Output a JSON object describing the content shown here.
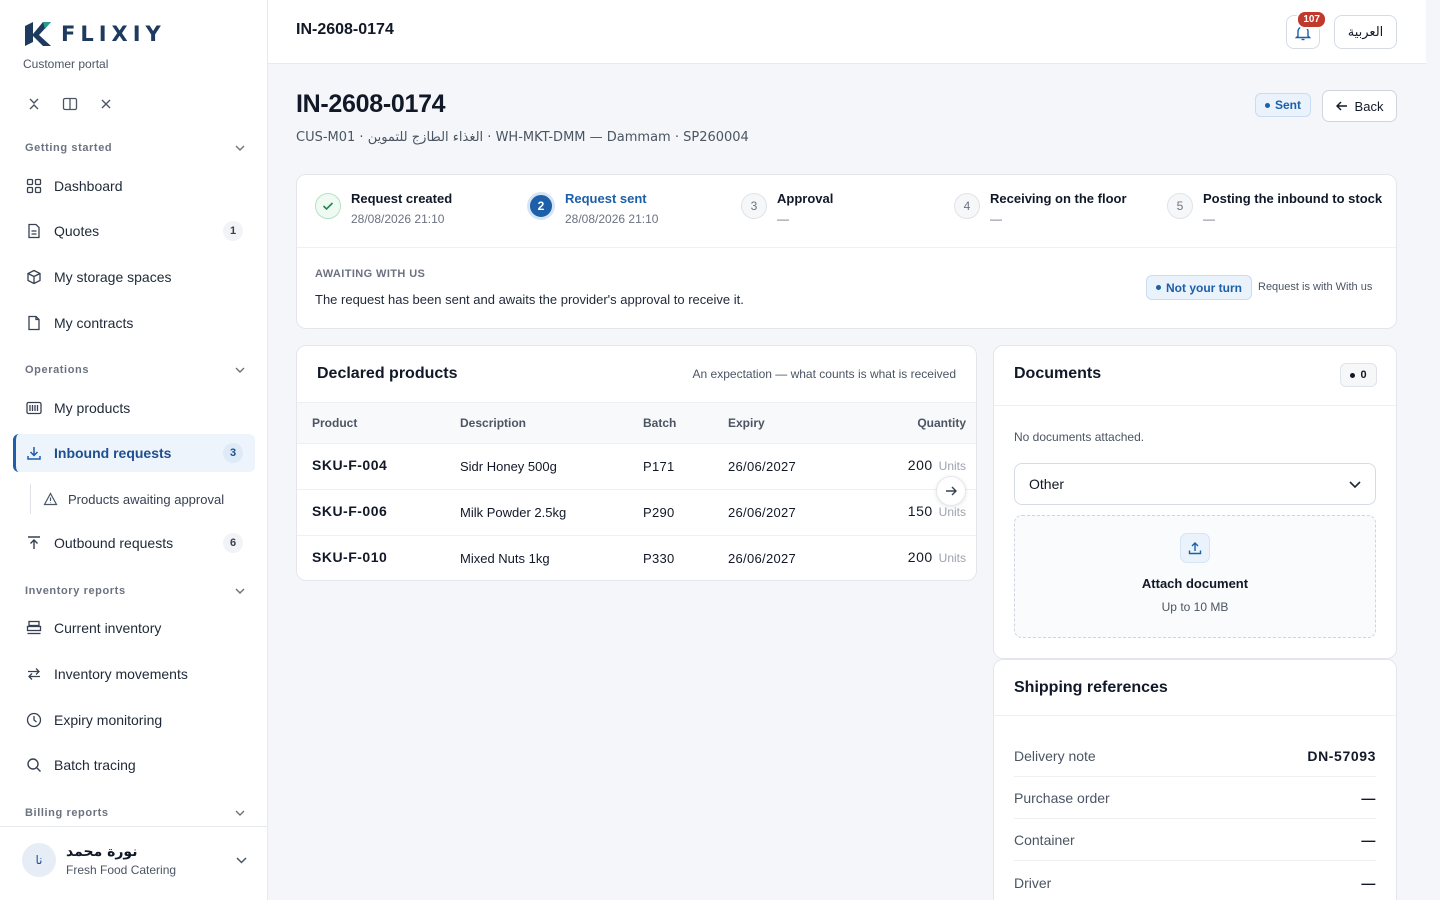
{
  "brand": {
    "name": "FLIXIY",
    "subtitle": "Customer portal"
  },
  "sidebar": {
    "sections": [
      {
        "label": "Getting started"
      },
      {
        "label": "Operations"
      },
      {
        "label": "Inventory reports"
      },
      {
        "label": "Billing reports"
      }
    ],
    "items": [
      {
        "label": "Dashboard",
        "icon": "grid-icon"
      },
      {
        "label": "Quotes",
        "count": "1",
        "icon": "document-icon"
      },
      {
        "label": "My storage spaces",
        "icon": "box-icon"
      },
      {
        "label": "My contracts",
        "icon": "file-icon"
      },
      {
        "label": "My products",
        "icon": "barcode-icon"
      },
      {
        "label": "Inbound requests",
        "count": "3",
        "icon": "download-icon",
        "active": true
      },
      {
        "label": "Products awaiting approval",
        "icon": "warning-icon"
      },
      {
        "label": "Outbound requests",
        "count": "6",
        "icon": "upload-icon"
      },
      {
        "label": "Current inventory",
        "icon": "stack-icon"
      },
      {
        "label": "Inventory movements",
        "icon": "swap-icon"
      },
      {
        "label": "Expiry monitoring",
        "icon": "clock-icon"
      },
      {
        "label": "Batch tracing",
        "icon": "search-icon"
      }
    ]
  },
  "user": {
    "initials": "نا",
    "name": "نورة محمد",
    "org": "Fresh Food Catering"
  },
  "topbar": {
    "title": "IN-2608-0174",
    "notifications": "107",
    "language": "العربية"
  },
  "page": {
    "title": "IN-2608-0174",
    "subtitle": "CUS-M01 · الغذاء الطازج للتموين · WH-MKT-DMM — Dammam · SP260004",
    "status": "Sent",
    "back": "Back"
  },
  "steps": [
    {
      "num": "1",
      "label": "Request created",
      "date": "28/08/2026 21:10",
      "state": "done"
    },
    {
      "num": "2",
      "label": "Request sent",
      "date": "28/08/2026 21:10",
      "state": "current"
    },
    {
      "num": "3",
      "label": "Approval",
      "date": "—",
      "state": "pending"
    },
    {
      "num": "4",
      "label": "Receiving on the floor",
      "date": "—",
      "state": "pending"
    },
    {
      "num": "5",
      "label": "Posting the inbound to stock",
      "date": "—",
      "state": "pending"
    }
  ],
  "awaiting": {
    "label": "AWAITING WITH US",
    "text": "The request has been sent and awaits the provider's approval to receive it.",
    "badge": "Not your turn",
    "note": "Request is with With us"
  },
  "products": {
    "title": "Declared products",
    "note": "An expectation — what counts is what is received",
    "columns": [
      "Product",
      "Description",
      "Batch",
      "Expiry",
      "Quantity"
    ],
    "unit": "Units",
    "rows": [
      {
        "sku": "SKU-F-004",
        "desc": "Sidr Honey 500g",
        "batch": "P171",
        "expiry": "26/06/2027",
        "qty": "200"
      },
      {
        "sku": "SKU-F-006",
        "desc": "Milk Powder 2.5kg",
        "batch": "P290",
        "expiry": "26/06/2027",
        "qty": "150"
      },
      {
        "sku": "SKU-F-010",
        "desc": "Mixed Nuts 1kg",
        "batch": "P330",
        "expiry": "26/06/2027",
        "qty": "200"
      }
    ]
  },
  "documents": {
    "title": "Documents",
    "count": "0",
    "empty": "No documents attached.",
    "type": "Other",
    "attach": "Attach document",
    "limit": "Up to 10 MB"
  },
  "shipping": {
    "title": "Shipping references",
    "rows": [
      {
        "label": "Delivery note",
        "value": "DN-57093"
      },
      {
        "label": "Purchase order",
        "value": "—"
      },
      {
        "label": "Container",
        "value": "—"
      },
      {
        "label": "Driver",
        "value": "—"
      }
    ]
  },
  "colors": {
    "accent": "#1d5fa8",
    "brand": "#1f3a5f",
    "success": "#1f8a4c",
    "alert": "#c0392b"
  }
}
